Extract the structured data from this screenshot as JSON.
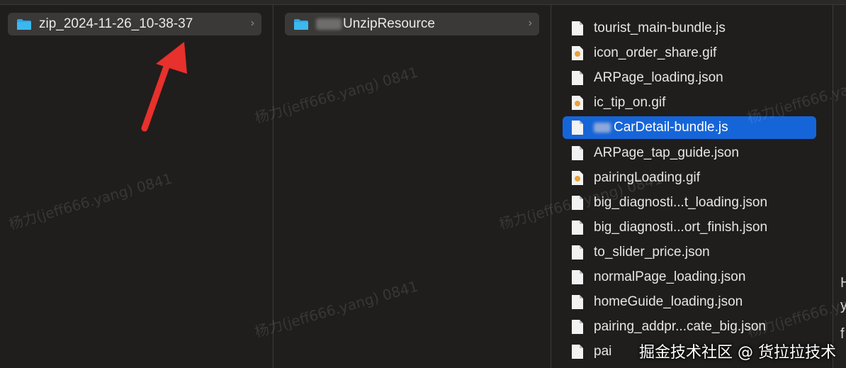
{
  "columns": {
    "col1": {
      "folder": {
        "name": "zip_2024-11-26_10-38-37",
        "chevron": "›"
      }
    },
    "col2": {
      "folder": {
        "name": "UnzipResource",
        "chevron": "›"
      }
    },
    "col3": {
      "files": [
        {
          "name": "tourist_main-bundle.js",
          "icon": "doc-icon"
        },
        {
          "name": "icon_order_share.gif",
          "icon": "image-icon"
        },
        {
          "name": "ARPage_loading.json",
          "icon": "doc-icon"
        },
        {
          "name": "ic_tip_on.gif",
          "icon": "image-icon"
        },
        {
          "name": "CarDetail-bundle.js",
          "icon": "doc-icon",
          "selected": true
        },
        {
          "name": "ARPage_tap_guide.json",
          "icon": "doc-icon"
        },
        {
          "name": "pairingLoading.gif",
          "icon": "image-icon"
        },
        {
          "name": "big_diagnosti...t_loading.json",
          "icon": "doc-icon"
        },
        {
          "name": "big_diagnosti...ort_finish.json",
          "icon": "doc-icon"
        },
        {
          "name": "to_slider_price.json",
          "icon": "doc-icon"
        },
        {
          "name": "normalPage_loading.json",
          "icon": "doc-icon"
        },
        {
          "name": "homeGuide_loading.json",
          "icon": "doc-icon"
        },
        {
          "name": "pairing_addpr...cate_big.json",
          "icon": "doc-icon"
        },
        {
          "name": "pai",
          "icon": "doc-icon"
        }
      ]
    },
    "col4": {
      "chars": [
        "H",
        "y",
        "f"
      ]
    }
  },
  "watermark_text": "杨力(jeff666.yang) 0841",
  "credit": "掘金技术社区 @ 货拉拉技术",
  "colors": {
    "selection": "#1665d8",
    "folder": "#29a6e8",
    "arrow": "#e8302c"
  }
}
